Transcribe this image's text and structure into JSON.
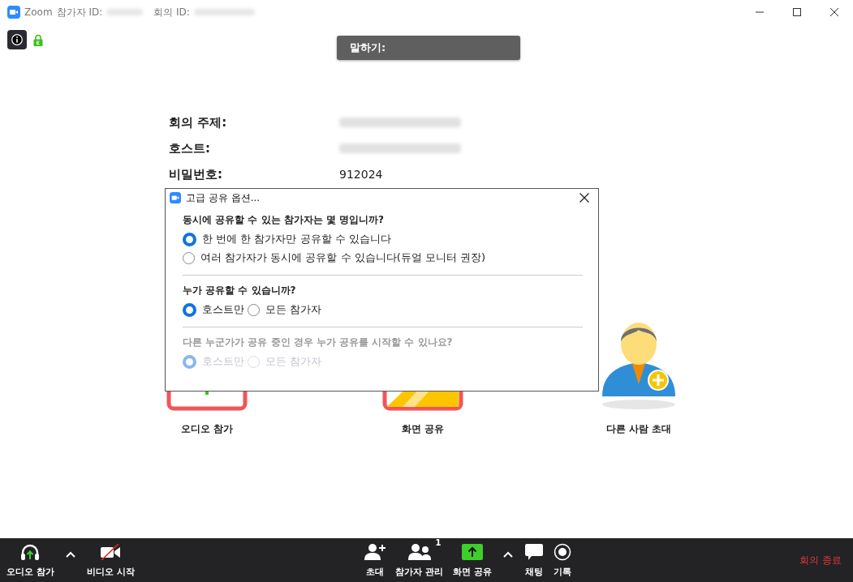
{
  "window": {
    "app": "Zoom",
    "participant_id_label": "참가자 ID:",
    "meeting_id_label": "회의 ID:"
  },
  "speaking": {
    "label": "말하기:"
  },
  "meeting_info": [
    {
      "label": "회의 주제:",
      "redacted": true
    },
    {
      "label": "호스트:",
      "redacted": true
    },
    {
      "label": "비밀번호:",
      "value": "912024"
    }
  ],
  "actions": [
    {
      "label": "오디오 참가",
      "kind": "audio"
    },
    {
      "label": "화면 공유",
      "kind": "share"
    },
    {
      "label": "다른 사람 초대",
      "kind": "invite"
    }
  ],
  "dialog": {
    "title": "고급 공유 옵션...",
    "sections": [
      {
        "question": "동시에 공유할 수 있는 참가자는 몇 명입니까?",
        "disabled": false,
        "kind": "stacked",
        "options": [
          {
            "label": "한 번에 한 참가자만 공유할 수 있습니다",
            "selected": true
          },
          {
            "label": "여러 참가자가 동시에 공유할 수 있습니다(듀얼 모니터 권장)",
            "selected": false
          }
        ]
      },
      {
        "question": "누가 공유할 수 있습니까?",
        "disabled": false,
        "kind": "inline",
        "options": [
          {
            "label": "호스트만",
            "selected": true
          },
          {
            "label": "모든 참가자",
            "selected": false
          }
        ]
      },
      {
        "question": "다른 누군가가 공유 중인 경우 누가 공유를 시작할 수 있나요?",
        "disabled": true,
        "kind": "inline",
        "options": [
          {
            "label": "호스트만",
            "selected": true
          },
          {
            "label": "모든 참가자",
            "selected": false
          }
        ]
      }
    ]
  },
  "toolbar": {
    "items": [
      {
        "kind": "audio",
        "label": "오디오 참가"
      },
      {
        "kind": "caret"
      },
      {
        "kind": "video",
        "label": "비디오 시작"
      },
      {
        "kind": "spacer"
      },
      {
        "kind": "invite",
        "label": "초대"
      },
      {
        "kind": "participants",
        "label": "참가자 관리",
        "badge": "1"
      },
      {
        "kind": "share",
        "label": "화면 공유"
      },
      {
        "kind": "caret"
      },
      {
        "kind": "chat",
        "label": "채팅"
      },
      {
        "kind": "record",
        "label": "기록"
      },
      {
        "kind": "spacer"
      }
    ],
    "end_button": "회의 종료"
  }
}
